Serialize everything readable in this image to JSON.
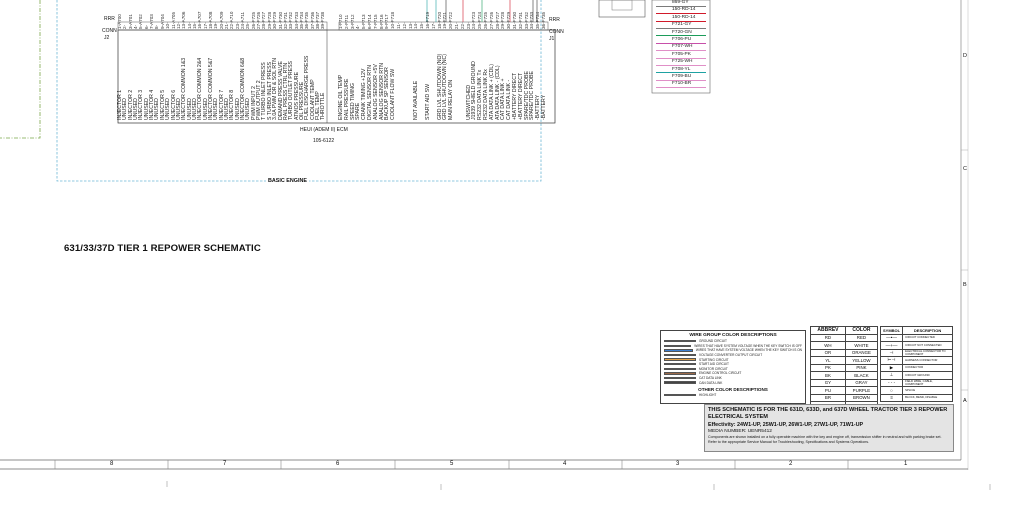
{
  "top": {
    "rrr_left": "RRR",
    "conn_left": "CONN",
    "j2": "J2",
    "rrr_right": "RRR",
    "conn_right": "CONN",
    "j1": "J1"
  },
  "ecm": {
    "name": "HEUI (ADEM II) ECM",
    "part": "105-6122"
  },
  "left_functions": [
    "INJECTOR 1",
    "UNUSED",
    "INJECTOR 2",
    "UNUSED",
    "INJECTOR 3",
    "UNUSED",
    "INJECTOR 4",
    "UNUSED",
    "INJECTOR 5",
    "UNUSED",
    "INJECTOR 6",
    "UNUSED",
    "INJECTOR COMMON 1&3",
    "UNUSED",
    "UNUSED",
    "INJECTOR COMMON 2&4",
    "UNUSED",
    "INJECTOR COMMON 5&7",
    "UNUSED",
    "INJECTOR 7",
    "UNUSED",
    "INJECTOR 8",
    "UNUSED",
    "INJECTOR COMMON 6&8",
    "UNUSED",
    "PWM INPUT 2",
    "PWM OUTPUT 2",
    "T TURBO INLET PRESS",
    "S TURBO INLET PRESS",
    "3.0A PWM DR & SOL RTN",
    "DEMAND PRESS VALVE",
    "RAIL PRESS CTRL RTN",
    "TURBO OUTLET PRESS",
    "ATMOS PRESSURE",
    "OIL PRESSURE",
    "FUEL DISCHARGE PRESS",
    "COOLANT TEMP",
    "FUEL TEMP",
    "THROTTLE"
  ],
  "right_functions": [
    "ENGINE OIL TEMP",
    "RAIL PRESSURE",
    "SPEED TIMING",
    "SPARE",
    "CRANK TIMING +12V",
    "DIGITAL SENSOR RTN",
    "ANALOG SENSOR +5V",
    "ANALOG SENSOR RTN",
    "BACKUP SP SENSOR",
    "COOLANT FLOW SW",
    "",
    "",
    "",
    "NOT AVAILABLE",
    "",
    "START AID SW",
    "",
    "GRD LVL SHUTDOWN (NO)",
    "GRD LVL SHUTDOWN (NC)",
    "MAIN RELAY ON",
    "",
    "",
    "UNSWITCHED",
    "J1939 SHIELD GROUND",
    "RS232 DATA LINK Tx",
    "RS232 DATA LINK Rx",
    "ATA DATA LINK + (CDL)",
    "ATA DATA LINK - (CDL)",
    "CAT DATA LINK +",
    "CAT DATA LINK -",
    "+BATTERY DIRECT",
    "+BATTERY DIRECT",
    "SPARE/TDC PROBE",
    "SPARE/TDC PROBE",
    "-BATTERY",
    "-BATTERY"
  ],
  "left_pins": [
    "1-A700",
    "2-",
    "3-A701",
    "4-",
    "5-A702",
    "6-",
    "7-A703",
    "8-",
    "9-A704",
    "10-",
    "11-A705",
    "12-",
    "13-A706",
    "14-",
    "15-",
    "16-A707",
    "17-",
    "18-A708",
    "19-",
    "20-A709",
    "21-",
    "22-A710",
    "23-",
    "24-A711",
    "25-",
    "26-F725",
    "27-F726",
    "28-F727",
    "29-F728",
    "30-F729",
    "31-F730",
    "32-F731",
    "33-F732",
    "34-F733",
    "35-F734",
    "36-F735",
    "37-F736",
    "38-F737",
    "39-F738"
  ],
  "right_pins": [
    "1-F710",
    "2-F711",
    "3-F712",
    "4-",
    "5-F713",
    "6-F714",
    "7-F715",
    "8-F716",
    "9-F717",
    "10-F718",
    "11-",
    "12-",
    "13-",
    "14-",
    "15-",
    "16-F719",
    "17-",
    "18-F720",
    "19-F721",
    "20-F722",
    "21-",
    "22-",
    "23-",
    "24-F723",
    "25-F724",
    "26-F725",
    "27-F726",
    "28-F727",
    "29-F728",
    "30-F729",
    "31-F730",
    "32-F731",
    "33-F732",
    "34-F733",
    "35-F734",
    "36-F735"
  ],
  "wire_list": [
    {
      "label": "869-GY",
      "color": "#7b7b7b"
    },
    {
      "label": "150-RD-14",
      "color": "#d11a2a"
    },
    {
      "label": "150-RD-14",
      "color": "#d11a2a"
    },
    {
      "label": "F721-GY",
      "color": "#7b7b7b"
    },
    {
      "label": "F720-GN",
      "color": "#1c9c5a"
    },
    {
      "label": "F706-PU",
      "color": "#c74fa9"
    },
    {
      "label": "F707-WH",
      "color": "#e08fc7"
    },
    {
      "label": "F705-PK",
      "color": "#e08fc7"
    },
    {
      "label": "F725-WH",
      "color": "#e08fc7"
    },
    {
      "label": "F708-YL",
      "color": "#1ea2a2"
    },
    {
      "label": "F709-BU",
      "color": "#e08fc7"
    },
    {
      "label": "F710-BR",
      "color": "#e08fc7"
    }
  ],
  "basic_engine": "BASIC ENGINE",
  "schematic_title": "631/33/37D TIER 1 REPOWER SCHEMATIC",
  "wire_group": {
    "title": "WIRE GROUP COLOR DESCRIPTIONS",
    "items": [
      {
        "color": "#222222",
        "text": "GROUND CIRCUIT"
      },
      {
        "color": "#d11a2a",
        "text": "WIRES THAT HAVE SYSTEM VOLTAGE WHEN THE KEY SWITCH IS OFF"
      },
      {
        "color": "#3d7fd1",
        "text": "WIRES THAT HAVE SYSTEM VOLTAGE WHEN THE KEY SWITCH IS ON"
      },
      {
        "color": "#7a4fa3",
        "text": "VOLTAGE CONVERTER OUTPUT CIRCUIT"
      },
      {
        "color": "#e2a24a",
        "text": "STARTING CIRCUIT"
      },
      {
        "color": "#e98a8a",
        "text": "START AID CIRCUIT"
      },
      {
        "color": "#d8d8d8",
        "text": "MONITOR CIRCUIT"
      },
      {
        "color": "#9b6a4a",
        "text": "ENGINE CONTROL CIRCUIT"
      },
      {
        "color": "#6aa86a",
        "text": "CAT DATA LINK"
      },
      {
        "color": "#444444",
        "text": "CAN DATA LINK"
      }
    ],
    "other_title": "OTHER COLOR DESCRIPTIONS",
    "other_items": [
      {
        "color": "#9ec7e8",
        "text": "HIGHLIGHT"
      }
    ]
  },
  "abbrev": {
    "headers": [
      "ABBREV",
      "COLOR"
    ],
    "rows": [
      [
        "RD",
        "RED"
      ],
      [
        "WH",
        "WHITE"
      ],
      [
        "OR",
        "ORANGE"
      ],
      [
        "YL",
        "YELLOW"
      ],
      [
        "PK",
        "PINK"
      ],
      [
        "BK",
        "BLACK"
      ],
      [
        "GY",
        "GRAY"
      ],
      [
        "PU",
        "PURPLE"
      ],
      [
        "BR",
        "BROWN"
      ],
      [
        "GN",
        "GREEN"
      ],
      [
        "BU",
        "BLUE"
      ]
    ]
  },
  "symbols": {
    "headers": [
      "SYMBOL",
      "DESCRIPTION"
    ],
    "rows": [
      {
        "symbol": "—•—",
        "text": "CIRCUIT CONNECTED"
      },
      {
        "symbol": "—+—",
        "text": "CIRCUIT NOT CONNECTED"
      },
      {
        "symbol": "⊣",
        "text": "ELECTRICAL CONNECTOR TO COMPONENT"
      },
      {
        "symbol": "⊢⊣",
        "text": "HARNESS CONNECTOR"
      },
      {
        "symbol": "▶",
        "text": "CONNECTOR"
      },
      {
        "symbol": "⊥",
        "text": "CIRCUIT GROUND"
      },
      {
        "symbol": "- - -",
        "text": "FIELD WIRE, CABLE, COMPONENT"
      },
      {
        "symbol": "○",
        "text": "SPLICE"
      },
      {
        "symbol": "≡",
        "text": "BLOCK, BEND, DISABLE"
      }
    ]
  },
  "info": {
    "heading": "THIS SCHEMATIC IS FOR THE 631D, 633D, and 637D WHEEL TRACTOR TIER 3 REPOWER ELECTRICAL SYSTEM",
    "effectivity": "Effectivity: 24W1-UP, 25W1-UP, 26W1-UP, 27W1-UP, 71W1-UP",
    "media": "MEDIA NUMBER: UENR5412",
    "note1": "Components are shown installed on a fully operable machine with the key and engine off, transmission shifter in neutral and with parking brake set.",
    "note2": "Refer to the appropriate Service Manual for Troubleshooting, Specifications and Systems Operations."
  },
  "zone_numbers": [
    "8",
    "7",
    "6",
    "5",
    "4",
    "3",
    "2",
    "1"
  ],
  "zone_letters": [
    "D",
    "C",
    "B",
    "A"
  ]
}
